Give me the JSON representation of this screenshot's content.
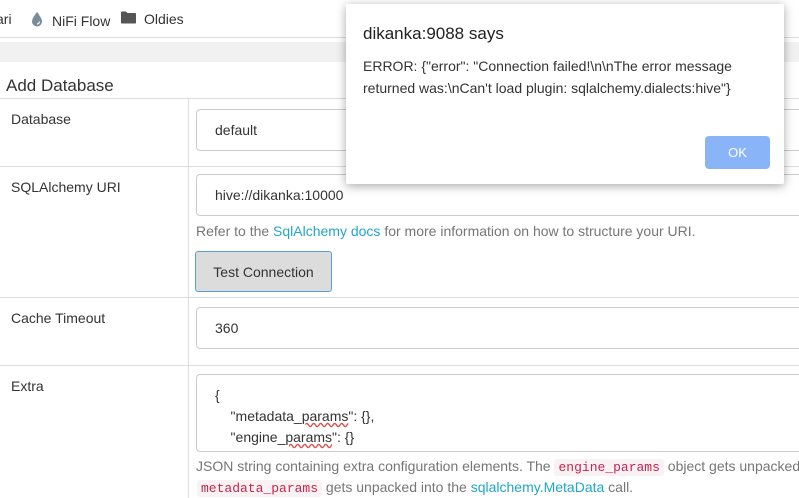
{
  "bookmarks": [
    {
      "label": "ari",
      "icon": "none"
    },
    {
      "label": "NiFi Flow",
      "icon": "water-drop-icon"
    },
    {
      "label": "Oldies",
      "icon": "folder-icon"
    }
  ],
  "page": {
    "title": "Add Database"
  },
  "form": {
    "database": {
      "label": "Database",
      "value": "default"
    },
    "uri": {
      "label": "SQLAlchemy URI",
      "value": "hive://dikanka:10000",
      "help_prefix": "Refer to the ",
      "help_link": "SqlAlchemy docs",
      "help_suffix": " for more information on how to structure your URI.",
      "test_button": "Test Connection"
    },
    "cache": {
      "label": "Cache Timeout",
      "value": "360"
    },
    "extra": {
      "label": "Extra",
      "line1": "{",
      "line2_pre": "    \"metadata_",
      "line2_sq": "params",
      "line2_post": "\": {},",
      "line3_pre": "    \"engine_",
      "line3_sq": "params",
      "line3_post": "\": {}",
      "line4": "}",
      "help1_text": "JSON string containing extra configuration elements. The ",
      "help1_code": "engine_params",
      "help1_suffix": " object gets unpacked into",
      "help2_code": "metadata_params",
      "help2_mid": " gets unpacked into the ",
      "help2_link": "sqlalchemy.MetaData",
      "help2_suffix": " call."
    }
  },
  "dialog": {
    "title": "dikanka:9088 says",
    "message": "ERROR: {\"error\": \"Connection failed!\\n\\nThe error message returned was:\\nCan't load plugin: sqlalchemy.dialects:hive\"}",
    "ok": "OK"
  },
  "colors": {
    "link": "#20a7c9",
    "ok_button": "#8ab4f8",
    "code_text": "#c7254e"
  }
}
